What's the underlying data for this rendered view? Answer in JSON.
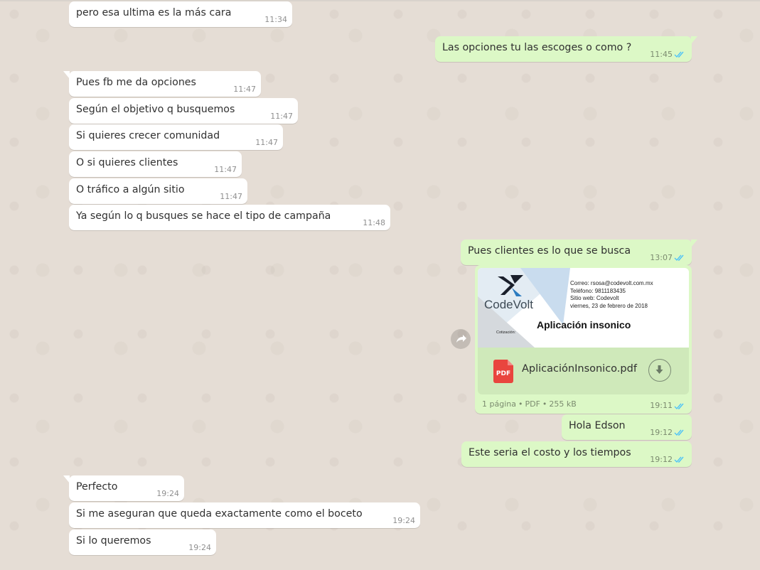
{
  "colors": {
    "chat_background": "#e5ddd5",
    "incoming_bubble": "#ffffff",
    "outgoing_bubble": "#dcf8c6",
    "read_ticks": "#4fc3f7",
    "pdf_icon": "#e9453e"
  },
  "messages": [
    {
      "text": "pero esa ultima es la más cara",
      "time": "11:34"
    },
    {
      "text": "Las opciones tu las escoges o como ?",
      "time": "11:45"
    },
    {
      "text": "Pues fb me da opciones",
      "time": "11:47"
    },
    {
      "text": "Según el objetivo q busquemos",
      "time": "11:47"
    },
    {
      "text": "Si quieres crecer comunidad",
      "time": "11:47"
    },
    {
      "text": "O si quieres clientes",
      "time": "11:47"
    },
    {
      "text": "O tráfico a algún sitio",
      "time": "11:47"
    },
    {
      "text": "Ya según lo q busques se hace el tipo de campaña",
      "time": "11:48"
    },
    {
      "text": "Pues clientes es lo que se busca",
      "time": "13:07"
    },
    {
      "text": "Hola Edson",
      "time": "19:12"
    },
    {
      "text": "Este seria el costo y los tiempos",
      "time": "19:12"
    },
    {
      "text": "Perfecto",
      "time": "19:24"
    },
    {
      "text": "Si me aseguran que queda exactamente como el boceto",
      "time": "19:24"
    },
    {
      "text": "Si lo queremos",
      "time": "19:24"
    }
  ],
  "document": {
    "file_name": "AplicaciónInsonico.pdf",
    "file_type_badge": "PDF",
    "pages": "1 página",
    "type": "PDF",
    "size": "255 kB",
    "time": "19:11",
    "preview": {
      "brand": "CodeVolt",
      "email": "Correo: rsosa@codevolt.com.mx",
      "phone": "Teléfono: 9811183435",
      "website": "Sitio web: Codevolt",
      "date": "viernes, 23 de febrero de 2018",
      "title": "Aplicación insonico",
      "label": "Cotización:"
    }
  },
  "icons": {
    "read_receipt": "double-check-icon",
    "forward": "forward-arrow-icon",
    "download": "download-arrow-icon",
    "pdf": "pdf-file-icon"
  }
}
